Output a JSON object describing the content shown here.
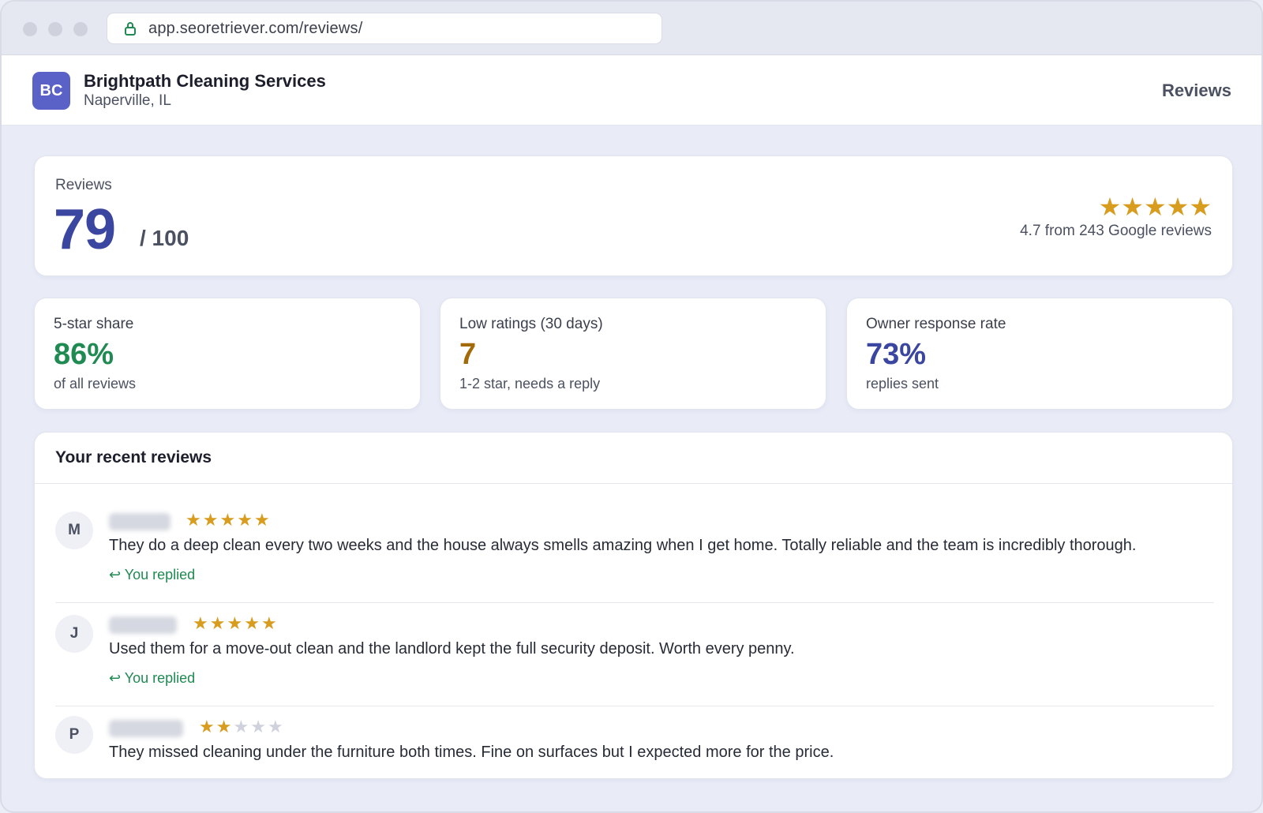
{
  "browser": {
    "url": "app.seoretriever.com/reviews/"
  },
  "header": {
    "logo_initials": "BC",
    "business_name": "Brightpath Cleaning Services",
    "location": "Naperville, IL",
    "nav_label": "Reviews"
  },
  "score": {
    "label": "Reviews",
    "value": "79",
    "out_of": "/ 100",
    "stars": "★★★★★",
    "rating_text": "4.7 from 243 Google reviews"
  },
  "metrics": [
    {
      "label": "5-star share",
      "value": "86%",
      "sub": "of all reviews",
      "color": "#1f8a52"
    },
    {
      "label": "Low ratings (30 days)",
      "value": "7",
      "sub": "1-2 star, needs a reply",
      "color": "#a36a09"
    },
    {
      "label": "Owner response rate",
      "value": "73%",
      "sub": "replies sent",
      "color": "#3b46a0"
    }
  ],
  "recent_reviews": {
    "title": "Your recent reviews",
    "items": [
      {
        "initial": "M",
        "rating": 5,
        "text": "They do a deep clean every two weeks and the house always smells amazing when I get home. Totally reliable and the team is incredibly thorough.",
        "replied": "↩ You replied"
      },
      {
        "initial": "J",
        "rating": 5,
        "text": "Used them for a move-out clean and the landlord kept the full security deposit. Worth every penny.",
        "replied": "↩ You replied"
      },
      {
        "initial": "P",
        "rating": 2,
        "text": "They missed cleaning under the furniture both times. Fine on surfaces but I expected more for the price.",
        "replied": ""
      }
    ]
  },
  "colors": {
    "star_filled": "#d89c1e",
    "star_empty": "#cfd2dc",
    "accent": "#3b46a0"
  }
}
